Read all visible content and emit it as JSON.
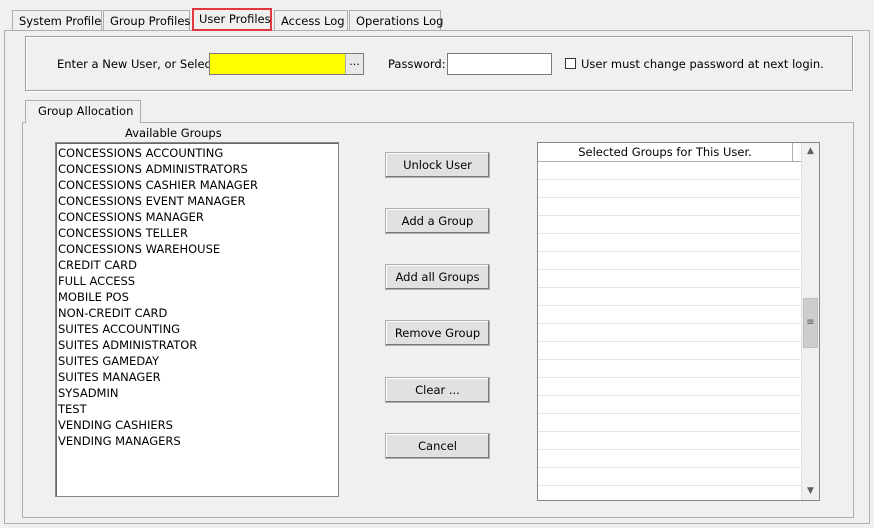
{
  "tabs": [
    {
      "label": "System Profile"
    },
    {
      "label": "Group Profiles"
    },
    {
      "label": "User Profiles"
    },
    {
      "label": "Access Log"
    },
    {
      "label": "Operations Log"
    }
  ],
  "header": {
    "user_label": "Enter a New User, or Select:",
    "user_value": "",
    "browse_label": "...",
    "password_label": "Password:",
    "password_value": "",
    "change_password_label": "User must change password at next login.",
    "change_password_checked": false,
    "user_field_color": "#ffff00"
  },
  "group_allocation": {
    "tab_label": "Group Allocation",
    "available_title": "Available Groups",
    "available_groups": [
      "CONCESSIONS ACCOUNTING",
      "CONCESSIONS ADMINISTRATORS",
      "CONCESSIONS CASHIER MANAGER",
      "CONCESSIONS EVENT MANAGER",
      "CONCESSIONS MANAGER",
      "CONCESSIONS TELLER",
      "CONCESSIONS WAREHOUSE",
      "CREDIT CARD",
      "FULL ACCESS",
      "MOBILE POS",
      "NON-CREDIT CARD",
      "SUITES ACCOUNTING",
      "SUITES ADMINISTRATOR",
      "SUITES GAMEDAY",
      "SUITES MANAGER",
      "SYSADMIN",
      "TEST",
      "VENDING CASHIERS",
      "VENDING MANAGERS"
    ],
    "buttons": {
      "unlock": "Unlock User",
      "add_group": "Add a Group",
      "add_all": "Add all Groups",
      "remove": "Remove Group",
      "clear": "Clear ...",
      "cancel": "Cancel"
    },
    "selected_header": "Selected Groups for This User.",
    "selected_groups": []
  },
  "icons": {
    "scroll_up": "▲",
    "scroll_down": "▼",
    "scroll_grip": "≡"
  },
  "colors": {
    "active_tab_border": "#e0383e",
    "user_field": "#ffff00"
  }
}
